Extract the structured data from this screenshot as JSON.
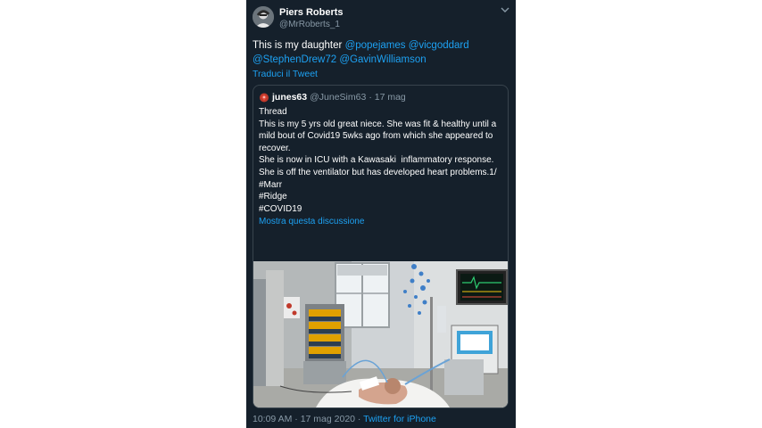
{
  "tweet": {
    "author_name": "Piers Roberts",
    "author_handle": "@MrRoberts_1",
    "text_prefix": "This is my daughter",
    "mentions": [
      "@popejames",
      "@vicgoddard",
      "@StephenDrew72",
      "@GavinWilliamson"
    ],
    "translate_label": "Traduci il Tweet",
    "timestamp": "10:09 AM · 17 mag 2020 · ",
    "source": "Twitter for iPhone"
  },
  "quoted": {
    "author_name": "junes63",
    "author_handle": "@JuneSim63",
    "date": "· 17 mag",
    "lines": [
      "Thread",
      "This is my 5 yrs old great niece. She was fit & healthy until a mild bout of Covid19 5wks ago from which she appeared to recover.",
      "She is now in ICU with a Kawasaki  inflammatory response.",
      "She is off the ventilator but has developed heart problems.1/",
      "#Marr",
      "#Ridge",
      "#COVID19"
    ],
    "show_thread_label": "Mostra questa discussione",
    "photo_subject": "hospital-icu-bed-photo"
  },
  "colors": {
    "background": "#15202b",
    "text": "#ffffff",
    "secondary": "#8899a6",
    "accent": "#1da1f2",
    "border": "#38444d"
  }
}
